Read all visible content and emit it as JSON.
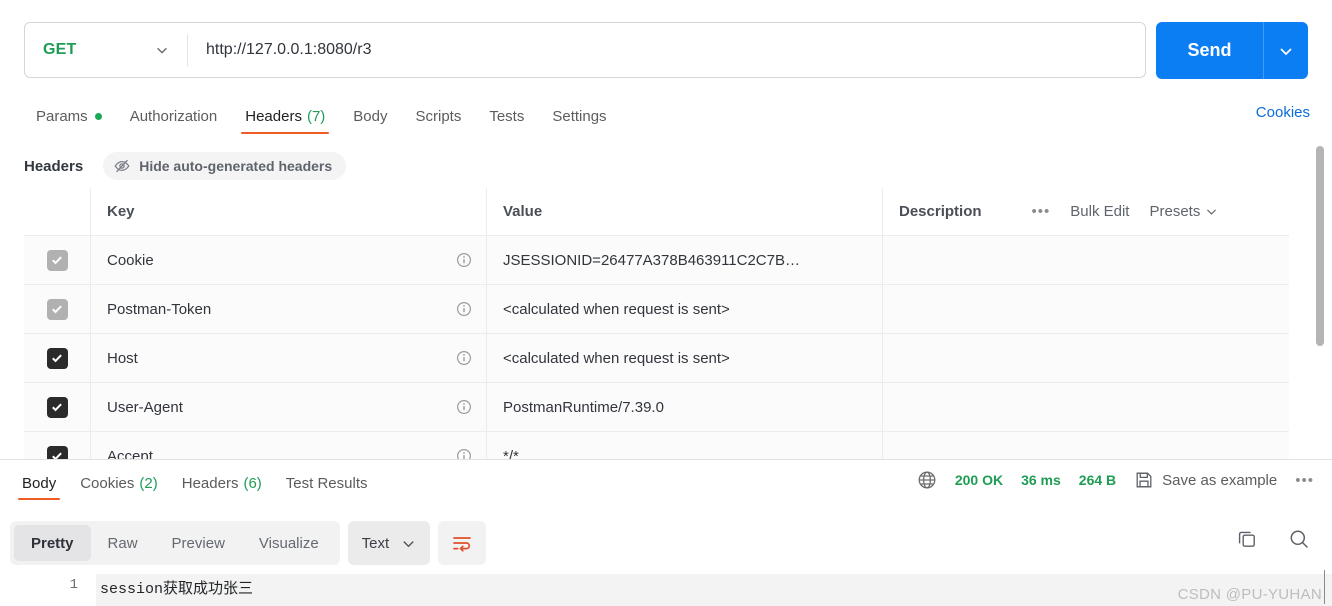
{
  "request": {
    "method": "GET",
    "method_caret_icon": "chevron-down-icon",
    "url_value": "http://127.0.0.1:8080/r3",
    "url_placeholder": "Enter URL or paste text",
    "send_label": "Send",
    "send_caret_icon": "chevron-down-icon",
    "tabs": [
      {
        "label": "Params",
        "badge": "",
        "has_dot": true,
        "active": false
      },
      {
        "label": "Authorization",
        "badge": "",
        "has_dot": false,
        "active": false
      },
      {
        "label": "Headers",
        "badge": "(7)",
        "has_dot": false,
        "active": true
      },
      {
        "label": "Body",
        "badge": "",
        "has_dot": false,
        "active": false
      },
      {
        "label": "Scripts",
        "badge": "",
        "has_dot": false,
        "active": false
      },
      {
        "label": "Tests",
        "badge": "",
        "has_dot": false,
        "active": false
      },
      {
        "label": "Settings",
        "badge": "",
        "has_dot": false,
        "active": false
      }
    ],
    "cookies_link": "Cookies"
  },
  "headers_panel": {
    "title": "Headers",
    "hide_auto_label": "Hide auto-generated headers",
    "hide_auto_icon": "eye-slash-icon",
    "columns": {
      "key": "Key",
      "value": "Value",
      "description": "Description"
    },
    "actions": {
      "more_icon": "ellipsis-icon",
      "bulk_edit": "Bulk Edit",
      "presets": "Presets",
      "presets_caret_icon": "chevron-down-icon"
    },
    "rows": [
      {
        "checked": true,
        "dim": true,
        "key": "Cookie",
        "value": "JSESSIONID=26477A378B463911C2C7B…",
        "description": "",
        "info_icon": "info-icon"
      },
      {
        "checked": true,
        "dim": true,
        "key": "Postman-Token",
        "value": "<calculated when request is sent>",
        "description": "",
        "info_icon": "info-icon"
      },
      {
        "checked": true,
        "dim": false,
        "key": "Host",
        "value": "<calculated when request is sent>",
        "description": "",
        "info_icon": "info-icon"
      },
      {
        "checked": true,
        "dim": false,
        "key": "User-Agent",
        "value": "PostmanRuntime/7.39.0",
        "description": "",
        "info_icon": "info-icon"
      },
      {
        "checked": true,
        "dim": false,
        "key": "Accept",
        "value": "*/*",
        "description": "",
        "info_icon": "info-icon"
      }
    ]
  },
  "response": {
    "tabs": [
      {
        "label": "Body",
        "badge": "",
        "active": true
      },
      {
        "label": "Cookies",
        "badge": "(2)",
        "active": false
      },
      {
        "label": "Headers",
        "badge": "(6)",
        "active": false
      },
      {
        "label": "Test Results",
        "badge": "",
        "active": false
      }
    ],
    "meta": {
      "globe_icon": "globe-icon",
      "status": "200 OK",
      "time": "36 ms",
      "size": "264 B",
      "save_icon": "save-icon",
      "save_label": "Save as example",
      "more_icon": "ellipsis-icon"
    },
    "view_modes": [
      {
        "label": "Pretty",
        "active": true
      },
      {
        "label": "Raw",
        "active": false
      },
      {
        "label": "Preview",
        "active": false
      },
      {
        "label": "Visualize",
        "active": false
      }
    ],
    "format": {
      "label": "Text",
      "caret_icon": "chevron-down-icon"
    },
    "wrap_icon": "word-wrap-icon",
    "copy_icon": "copy-icon",
    "search_icon": "search-icon",
    "body": {
      "line_number": "1",
      "line_text": "session获取成功张三"
    }
  },
  "watermark": "CSDN @PU-YUHAN",
  "colors": {
    "accent_orange": "#ef5b25",
    "send_blue": "#0b7ef4",
    "link_blue": "#0b6bdb",
    "green": "#1f9d55",
    "method_green": "#1f9d55"
  }
}
